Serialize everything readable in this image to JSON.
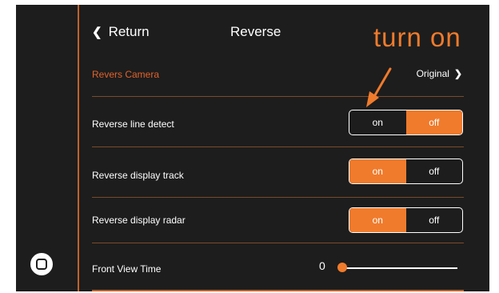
{
  "header": {
    "return_label": "Return",
    "title": "Reverse"
  },
  "annotation": {
    "text": "turn on"
  },
  "camera": {
    "label": "Revers Camera",
    "value": "Original"
  },
  "rows": [
    {
      "label": "Reverse line detect",
      "on_label": "on",
      "off_label": "off",
      "selected": "off"
    },
    {
      "label": "Reverse display track",
      "on_label": "on",
      "off_label": "off",
      "selected": "on"
    },
    {
      "label": "Reverse display radar",
      "on_label": "on",
      "off_label": "off",
      "selected": "on"
    }
  ],
  "front_view": {
    "label": "Front View Time",
    "value": "0"
  },
  "colors": {
    "accent": "#f07b2c",
    "background": "#1d1d1d"
  }
}
